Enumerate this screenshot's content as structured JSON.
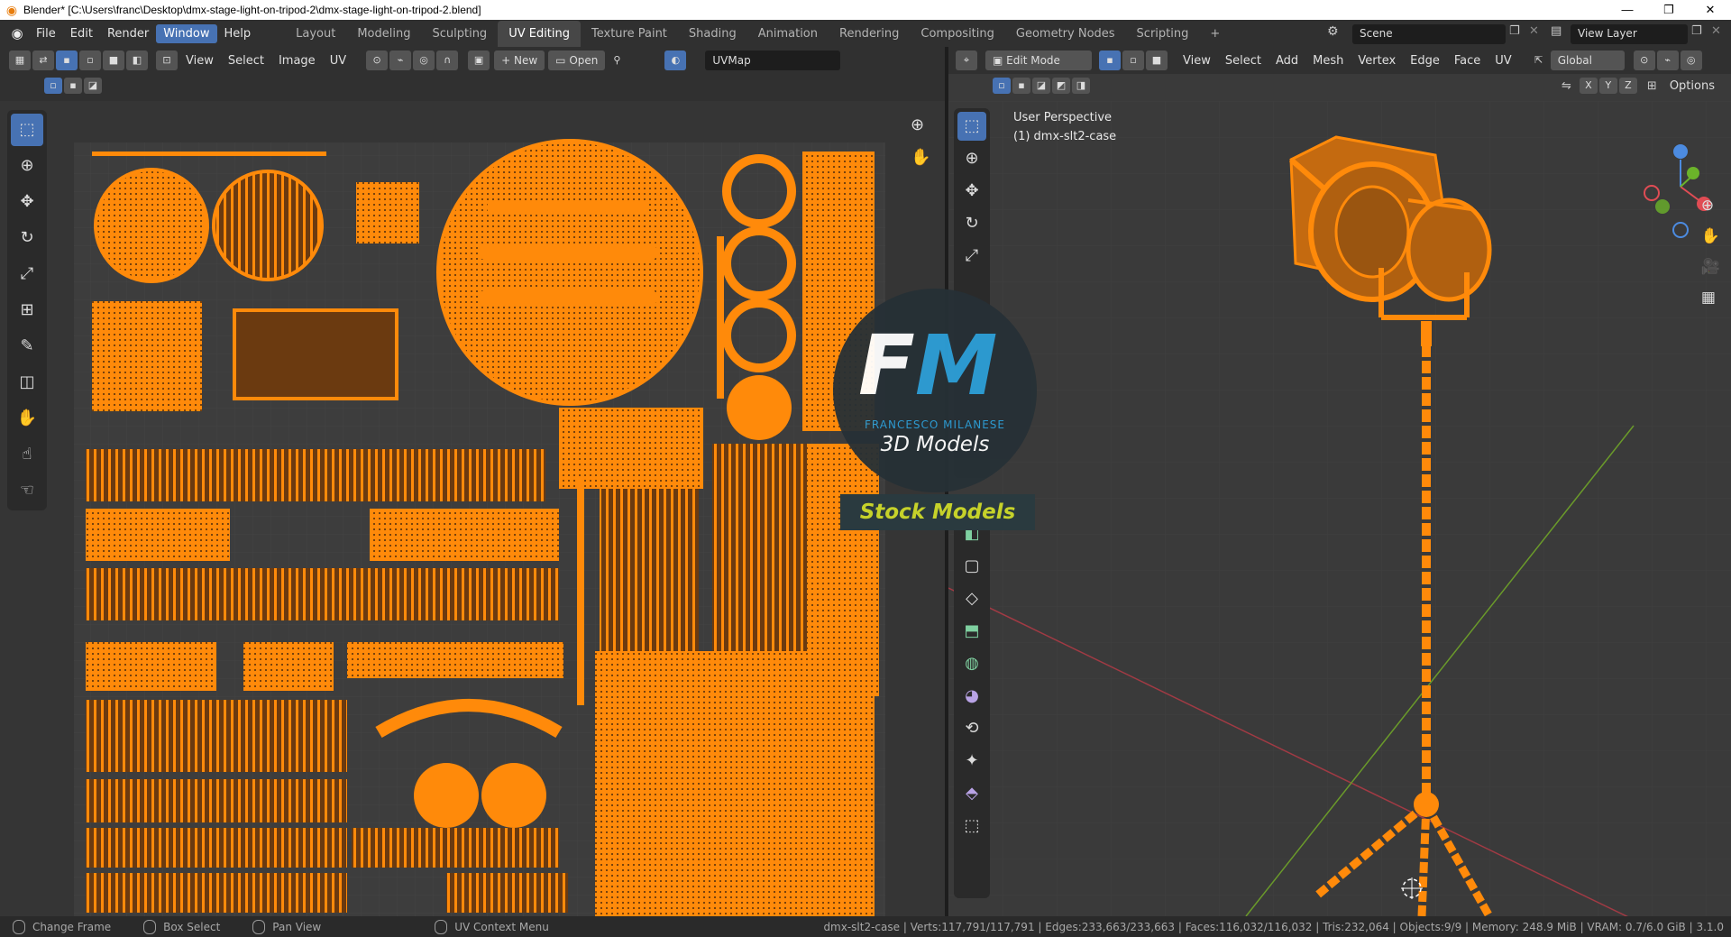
{
  "titlebar": {
    "text": "Blender* [C:\\Users\\franc\\Desktop\\dmx-stage-light-on-tripod-2\\dmx-stage-light-on-tripod-2.blend]",
    "minimize": "—",
    "maximize": "❐",
    "close": "✕"
  },
  "menubar": {
    "items": [
      "File",
      "Edit",
      "Render",
      "Window",
      "Help"
    ],
    "active": "Window"
  },
  "workspaces": {
    "tabs": [
      "Layout",
      "Modeling",
      "Sculpting",
      "UV Editing",
      "Texture Paint",
      "Shading",
      "Animation",
      "Rendering",
      "Compositing",
      "Geometry Nodes",
      "Scripting"
    ],
    "active": "UV Editing",
    "add": "+"
  },
  "scene": {
    "label": "Scene",
    "view_layer": "View Layer"
  },
  "uv_editor": {
    "menus": [
      "View",
      "Select",
      "Image",
      "UV"
    ],
    "new_label": "New",
    "open_label": "Open",
    "uvmap": "UVMap"
  },
  "viewport": {
    "mode": "Edit Mode",
    "menus": [
      "View",
      "Select",
      "Add",
      "Mesh",
      "Vertex",
      "Edge",
      "Face",
      "UV"
    ],
    "orientation": "Global",
    "axes": [
      "X",
      "Y",
      "Z"
    ],
    "options": "Options",
    "perspective": "User Perspective",
    "object": "(1) dmx-slt2-case"
  },
  "watermark": {
    "initials": "FM",
    "name": "FRANCESCO MILANESE",
    "tagline": "3D Models",
    "banner": "Stock Models"
  },
  "statusbar": {
    "hints": [
      "Change Frame",
      "Box Select",
      "Pan View",
      "UV Context Menu"
    ],
    "stats": "dmx-slt2-case | Verts:117,791/117,791 | Edges:233,663/233,663 | Faces:116,032/116,032 | Tris:232,064 | Objects:9/9 | Memory: 248.9 MiB | VRAM: 0.7/6.0 GiB | 3.1.0"
  },
  "colors": {
    "accent": "#4772b3",
    "mesh": "#ff8a0a",
    "uv_bg": "#3d3d3d",
    "viewport_bg": "#3a3a3a"
  }
}
